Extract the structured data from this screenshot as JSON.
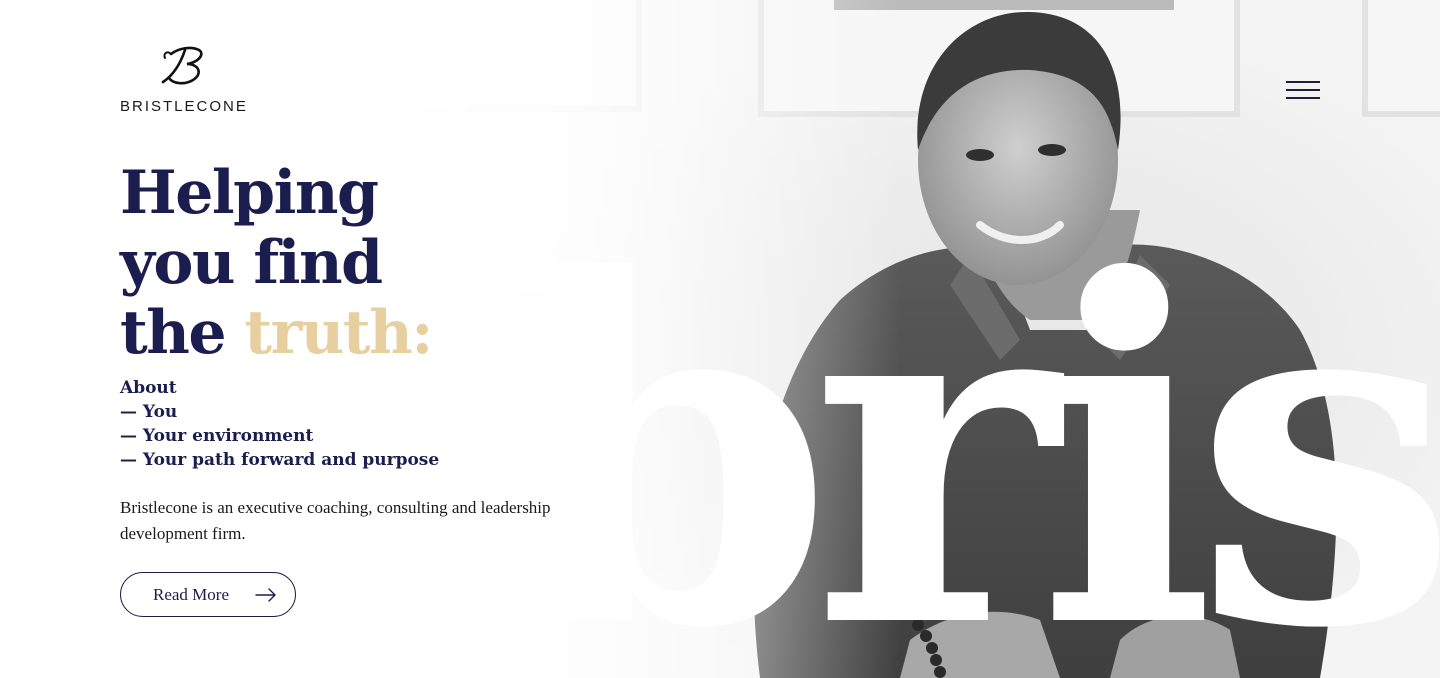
{
  "brand": {
    "name": "BRISTLECONE"
  },
  "hero": {
    "headline_line1": "Helping",
    "headline_line2": "you find",
    "headline_line3_prefix": "the ",
    "headline_accent": "truth:",
    "accent_color": "#e8cfa0",
    "primary_color": "#1b1d4e",
    "about_heading": "About",
    "about_items": [
      "— You",
      "— Your environment",
      "— Your path forward and purpose"
    ],
    "description": "Bristlecone is an executive coaching, consulting and leadership development firm.",
    "cta_label": "Read More",
    "background_word": "brist"
  },
  "header": {
    "menu_icon": "hamburger-menu-icon"
  }
}
